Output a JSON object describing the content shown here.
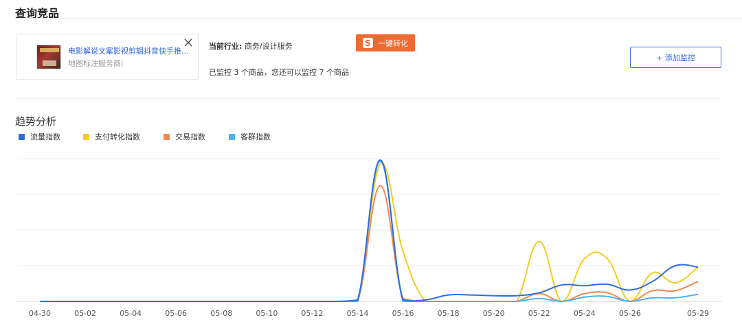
{
  "header": {
    "title": "查询竞品"
  },
  "product": {
    "name": "电影解说文案影视剪辑抖音快手推...",
    "shop": "地图标注服务商i"
  },
  "industry": {
    "label": "当前行业:",
    "value": "商务/设计服务"
  },
  "monitor_info": "已监控 3 个商品，您还可以监控 7 个商品",
  "buttons": {
    "convert": "一键转化",
    "convert_icon_glyph": "S",
    "add_monitor": "+ 添加监控"
  },
  "trend": {
    "title": "趋势分析"
  },
  "icons": {
    "close": "close-icon",
    "convert": "convert-icon"
  },
  "colors": {
    "accent_blue": "#2f63d8",
    "convert_orange": "#ef6a32"
  },
  "chart_data": {
    "type": "line",
    "title": "",
    "xlabel": "",
    "ylabel": "",
    "grid": true,
    "legend_position": "top-left",
    "x_tick_labels": [
      "04-30",
      "05-02",
      "05-04",
      "05-06",
      "05-08",
      "05-10",
      "05-12",
      "05-14",
      "05-16",
      "05-18",
      "05-20",
      "05-22",
      "05-24",
      "05-26",
      "05-29"
    ],
    "x": [
      "04-30",
      "05-01",
      "05-02",
      "05-03",
      "05-04",
      "05-05",
      "05-06",
      "05-07",
      "05-08",
      "05-09",
      "05-10",
      "05-11",
      "05-12",
      "05-13",
      "05-14",
      "05-15",
      "05-16",
      "05-17",
      "05-18",
      "05-19",
      "05-20",
      "05-21",
      "05-22",
      "05-23",
      "05-24",
      "05-25",
      "05-26",
      "05-27",
      "05-28",
      "05-29"
    ],
    "ylim": [
      0,
      100
    ],
    "series": [
      {
        "name": "流量指数",
        "color": "#2f6de1",
        "values": [
          0,
          0,
          0,
          0,
          0,
          0,
          0,
          0,
          0,
          0,
          0,
          0,
          0,
          0,
          1,
          99,
          1,
          1,
          4.5,
          4.5,
          4,
          4,
          6,
          11.5,
          11,
          12,
          8,
          14,
          25,
          24
        ]
      },
      {
        "name": "支付转化指数",
        "color": "#f2cc22",
        "values": [
          0,
          0,
          0,
          0,
          0,
          0,
          0,
          0,
          0,
          0,
          0,
          0,
          0,
          0,
          0,
          96,
          35,
          0,
          0,
          0,
          0,
          0,
          42,
          0,
          30,
          30,
          0,
          20,
          13,
          24
        ]
      },
      {
        "name": "交易指数",
        "color": "#f5884a",
        "values": [
          0,
          0,
          0,
          0,
          0,
          0,
          0,
          0,
          0,
          0,
          0,
          0,
          0,
          0,
          0,
          81,
          2,
          0,
          0,
          0,
          0,
          0,
          5.5,
          0,
          5.5,
          6,
          0,
          7.5,
          7.5,
          14
        ]
      },
      {
        "name": "客群指数",
        "color": "#4fb0f2",
        "values": [
          0,
          0,
          0,
          0,
          0,
          0,
          0,
          0,
          0,
          0,
          0,
          0,
          0,
          0,
          0,
          98,
          0,
          0,
          0,
          0,
          0,
          0,
          2,
          0,
          3,
          3.5,
          0,
          2.5,
          2.5,
          5
        ]
      }
    ]
  }
}
